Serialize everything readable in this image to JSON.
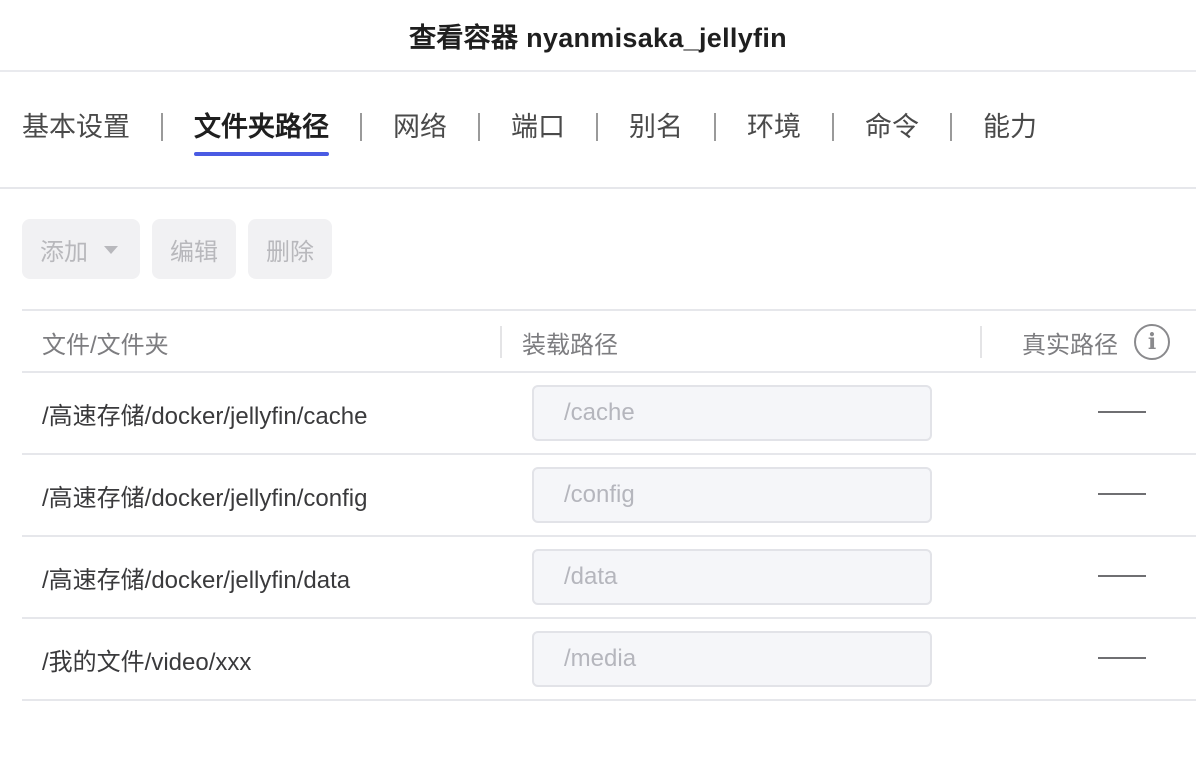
{
  "window": {
    "title": "查看容器 nyanmisaka_jellyfin"
  },
  "tabs": [
    {
      "label": "基本设置",
      "active": false
    },
    {
      "label": "文件夹路径",
      "active": true
    },
    {
      "label": "网络",
      "active": false
    },
    {
      "label": "端口",
      "active": false
    },
    {
      "label": "别名",
      "active": false
    },
    {
      "label": "环境",
      "active": false
    },
    {
      "label": "命令",
      "active": false
    },
    {
      "label": "能力",
      "active": false
    }
  ],
  "toolbar": {
    "add_label": "添加",
    "edit_label": "编辑",
    "delete_label": "删除"
  },
  "table": {
    "headers": {
      "file": "文件/文件夹",
      "mount": "装载路径",
      "real": "真实路径"
    },
    "rows": [
      {
        "path": "/高速存储/docker/jellyfin/cache",
        "mount": "/cache",
        "real": "—"
      },
      {
        "path": "/高速存储/docker/jellyfin/config",
        "mount": "/config",
        "real": "—"
      },
      {
        "path": "/高速存储/docker/jellyfin/data",
        "mount": "/data",
        "real": "—"
      },
      {
        "path": "/我的文件/video/xxx",
        "mount": "/media",
        "real": "—"
      }
    ]
  },
  "icons": {
    "info": "info-icon",
    "add_caret": "caret-down-icon"
  },
  "colors": {
    "accent": "#4a5be3",
    "disabled_text": "#b8b8bc",
    "button_bg": "#f1f1f3"
  }
}
